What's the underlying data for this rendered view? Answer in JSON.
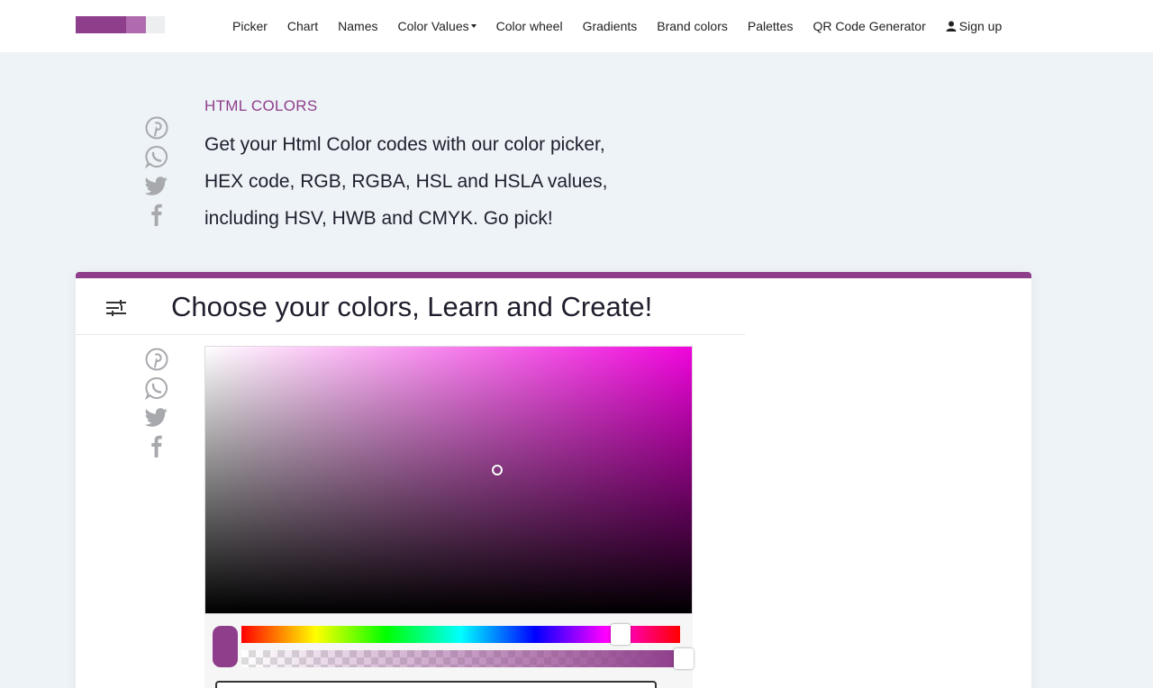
{
  "nav": {
    "logo_colors": [
      "#8f3e8b",
      "#b06aae",
      "#eceef0"
    ],
    "items": [
      {
        "label": "Picker"
      },
      {
        "label": "Chart"
      },
      {
        "label": "Names"
      },
      {
        "label": "Color Values",
        "has_dropdown": true
      },
      {
        "label": "Color wheel"
      },
      {
        "label": "Gradients"
      },
      {
        "label": "Brand colors"
      },
      {
        "label": "Palettes"
      },
      {
        "label": "QR Code Generator"
      }
    ],
    "signup_label": "Sign up"
  },
  "share_icons": [
    "pinterest-icon",
    "whatsapp-icon",
    "twitter-icon",
    "facebook-icon"
  ],
  "hero": {
    "eyebrow": "HTML COLORS",
    "lines": [
      "Get your Html Color codes with our color picker,",
      "HEX code, RGB, RGBA, HSL and HSLA values,",
      "including HSV, HWB and CMYK. Go pick!"
    ]
  },
  "card": {
    "title": "Choose your colors, Learn and Create!",
    "accent_color": "#8f3e8b"
  },
  "picker": {
    "hue_color": "#f005dc",
    "selected_color": "#8f3e8b",
    "hex_value": "#8F3A84",
    "alpha": 1.0
  }
}
